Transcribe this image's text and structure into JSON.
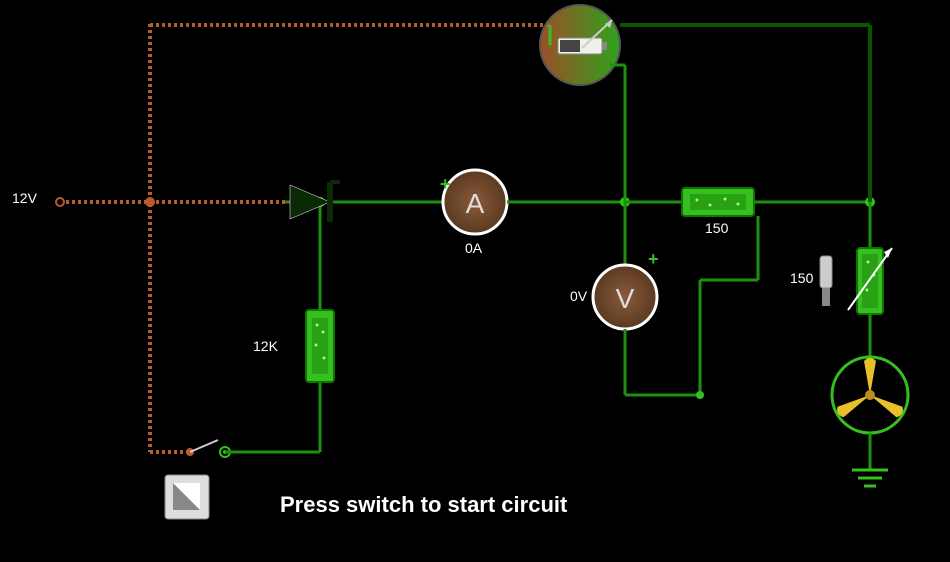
{
  "chart_data": {
    "type": "circuit-diagram",
    "source_voltage": "12V",
    "components": [
      {
        "name": "voltage-source",
        "value": "12V"
      },
      {
        "name": "switch",
        "state": "open"
      },
      {
        "name": "diode"
      },
      {
        "name": "resistor-R1",
        "value": "12K"
      },
      {
        "name": "ammeter",
        "reading": "0A"
      },
      {
        "name": "voltmeter",
        "reading": "0V"
      },
      {
        "name": "battery-meter"
      },
      {
        "name": "resistor-R2",
        "value": "150"
      },
      {
        "name": "variable-resistor",
        "value": "150"
      },
      {
        "name": "motor-fan"
      },
      {
        "name": "ground"
      }
    ],
    "instruction": "Press switch to start circuit"
  },
  "labels": {
    "source": "12V",
    "r1": "12K",
    "ammeter": "0A",
    "voltmeter": "0V",
    "r2": "150",
    "varres": "150",
    "plus1": "+",
    "plus2": "+",
    "instruction": "Press switch to start circuit"
  }
}
